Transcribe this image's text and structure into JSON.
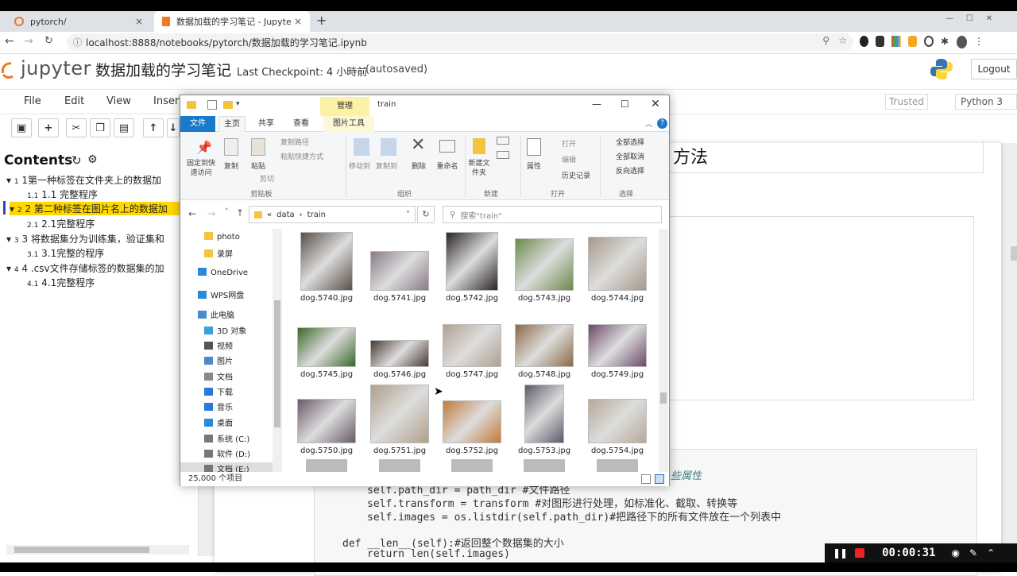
{
  "browser": {
    "tabs": [
      {
        "title": "pytorch/",
        "close": "×"
      },
      {
        "title": "数据加载的学习笔记 - Jupyter N",
        "close": "×"
      }
    ],
    "new_tab": "+",
    "url": "localhost:8888/notebooks/pytorch/数据加载的学习笔记.ipynb"
  },
  "jupyter": {
    "logo": "jupyter",
    "notebook_title": "数据加载的学习笔记",
    "checkpoint": "Last Checkpoint: 4 小時前",
    "autosaved": "(autosaved)",
    "logout": "Logout",
    "menu": [
      "File",
      "Edit",
      "View",
      "Insert"
    ],
    "trusted": "Trusted",
    "kernel": "Python 3"
  },
  "toc": {
    "title": "Contents",
    "items": [
      {
        "num": "1",
        "text": "1第一种标签在文件夹上的数据加"
      },
      {
        "num": "1.1",
        "text": "1.1 完整程序"
      },
      {
        "num": "2",
        "text": "2 第二种标签在图片名上的数据加"
      },
      {
        "num": "2.1",
        "text": "2.1完整程序"
      },
      {
        "num": "3",
        "text": "3 将数据集分为训练集，验证集和"
      },
      {
        "num": "3.1",
        "text": "3.1完整的程序"
      },
      {
        "num": "4",
        "text": "4 .csv文件存储标签的数据集的加"
      },
      {
        "num": "4.1",
        "text": "4.1完整程序"
      }
    ]
  },
  "notebook": {
    "heading_tail": "方法",
    "comment_tail": "些属性",
    "code_lines": [
      "self.path_dir = path_dir #文件路径",
      "self.transform = transform #对图形进行处理，如标准化、截取、转换等",
      "self.images = os.listdir(self.path_dir)#把路径下的所有文件放在一个列表中",
      "def __len__(self):#返回整个数据集的大小",
      "return len(self.images)"
    ]
  },
  "explorer": {
    "title_tool": "管理",
    "title": "train",
    "ribbon_tabs": [
      "文件",
      "主页",
      "共享",
      "查看",
      "图片工具"
    ],
    "ribbon": {
      "pin": "固定到快速访问",
      "copy": "复制",
      "paste": "粘贴",
      "copy_path": "复制路径",
      "paste_shortcut": "粘贴快捷方式",
      "cut": "剪切",
      "clipboard": "剪贴板",
      "move_to": "移动到",
      "copy_to": "复制到",
      "delete": "删除",
      "rename": "重命名",
      "organize": "组织",
      "new_folder": "新建文件夹",
      "new": "新建",
      "properties": "属性",
      "open": "打开",
      "edit": "编辑",
      "history": "历史记录",
      "open_group": "打开",
      "select_all": "全部选择",
      "select_none": "全部取消",
      "invert": "反向选择",
      "select": "选择"
    },
    "breadcrumb": [
      "«",
      "data",
      "›",
      "train"
    ],
    "search_placeholder": "搜索\"train\"",
    "nav": [
      {
        "label": "photo",
        "icon": "folder-icon"
      },
      {
        "label": "录屏",
        "icon": "folder-icon"
      },
      {
        "label": "OneDrive",
        "icon": "cloud-icon"
      },
      {
        "label": "WPS网盘",
        "icon": "cloud-icon"
      },
      {
        "label": "此电脑",
        "icon": "computer-icon"
      },
      {
        "label": "3D 对象",
        "icon": "cube-icon"
      },
      {
        "label": "视频",
        "icon": "video-icon"
      },
      {
        "label": "图片",
        "icon": "picture-icon"
      },
      {
        "label": "文档",
        "icon": "document-icon"
      },
      {
        "label": "下载",
        "icon": "download-icon"
      },
      {
        "label": "音乐",
        "icon": "music-icon"
      },
      {
        "label": "桌面",
        "icon": "desktop-icon"
      },
      {
        "label": "系统 (C:)",
        "icon": "drive-icon"
      },
      {
        "label": "软件 (D:)",
        "icon": "drive-icon"
      },
      {
        "label": "文档 (E:)",
        "icon": "drive-icon"
      }
    ],
    "files": [
      {
        "name": "dog.5740.jpg",
        "color": "#5a5048"
      },
      {
        "name": "dog.5741.jpg",
        "color": "#8a7a88"
      },
      {
        "name": "dog.5742.jpg",
        "color": "#2a2424"
      },
      {
        "name": "dog.5743.jpg",
        "color": "#6a8a4a"
      },
      {
        "name": "dog.5744.jpg",
        "color": "#a89888"
      },
      {
        "name": "dog.5745.jpg",
        "color": "#3a6a2a"
      },
      {
        "name": "dog.5746.jpg",
        "color": "#4a3a34"
      },
      {
        "name": "dog.5747.jpg",
        "color": "#b0a090"
      },
      {
        "name": "dog.5748.jpg",
        "color": "#8a6a44"
      },
      {
        "name": "dog.5749.jpg",
        "color": "#6a4a6a"
      },
      {
        "name": "dog.5750.jpg",
        "color": "#6a5a6a"
      },
      {
        "name": "dog.5751.jpg",
        "color": "#b0a08a"
      },
      {
        "name": "dog.5752.jpg",
        "color": "#c07a3a"
      },
      {
        "name": "dog.5753.jpg",
        "color": "#5a5a6a"
      },
      {
        "name": "dog.5754.jpg",
        "color": "#b8a898"
      }
    ],
    "status": "25,000 个项目"
  },
  "recorder": {
    "time": "00:00:31"
  }
}
